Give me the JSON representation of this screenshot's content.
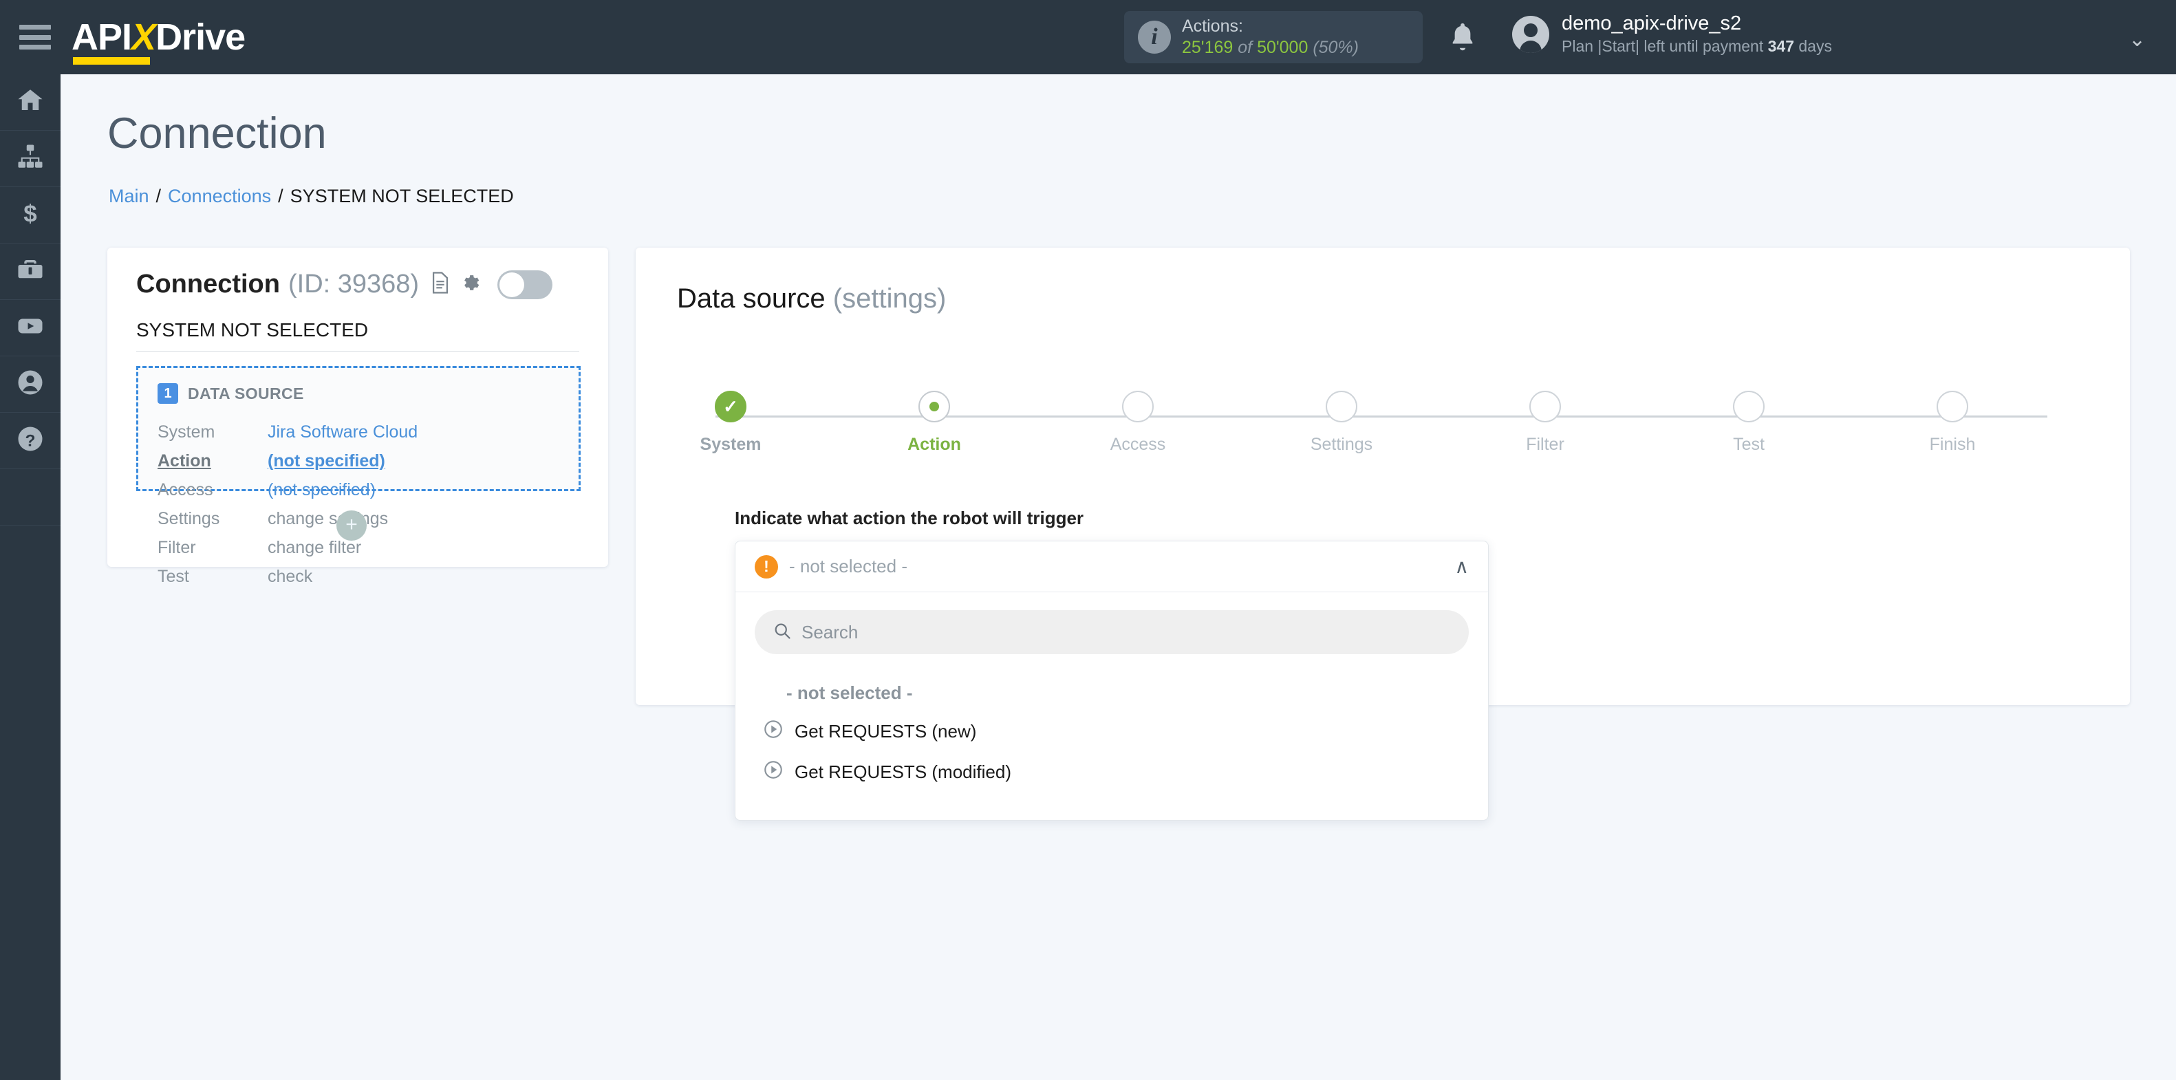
{
  "topbar": {
    "menu_icon": "hamburger-icon",
    "logo": {
      "part1": "API",
      "part2": "X",
      "part3": "Drive"
    },
    "actions": {
      "icon": "info-icon",
      "title": "Actions:",
      "used": "25'169",
      "of": "of",
      "total": "50'000",
      "percent": "(50%)"
    },
    "notifications_icon": "bell-icon",
    "user": {
      "avatar_icon": "user-avatar-icon",
      "name": "demo_apix-drive_s2",
      "plan_prefix": "Plan |Start| left until payment ",
      "plan_days": "347",
      "plan_suffix": " days",
      "chevron_icon": "chevron-down-icon"
    }
  },
  "sidebar": {
    "items": [
      {
        "icon": "home-icon",
        "name": "home"
      },
      {
        "icon": "connections-icon",
        "name": "connections"
      },
      {
        "icon": "dollar-icon",
        "name": "billing"
      },
      {
        "icon": "briefcase-icon",
        "name": "business"
      },
      {
        "icon": "youtube-icon",
        "name": "video"
      },
      {
        "icon": "account-icon",
        "name": "account"
      },
      {
        "icon": "help-icon",
        "name": "help"
      }
    ]
  },
  "page": {
    "title": "Connection",
    "breadcrumb": {
      "main": "Main",
      "connections": "Connections",
      "current": "SYSTEM NOT SELECTED",
      "separator": "/"
    }
  },
  "connection_card": {
    "title": "Connection",
    "id_label": "(ID: 39368)",
    "doc_icon": "document-icon",
    "gear_icon": "gear-icon",
    "toggle_state": "off",
    "subtitle": "SYSTEM NOT SELECTED",
    "data_source": {
      "badge": "1",
      "heading": "DATA SOURCE",
      "rows": [
        {
          "key": "System",
          "value": "Jira Software Cloud",
          "style": "link",
          "active": false
        },
        {
          "key": "Action",
          "value": "(not specified)",
          "style": "link",
          "active": true
        },
        {
          "key": "Access",
          "value": "(not specified)",
          "style": "link",
          "active": false
        },
        {
          "key": "Settings",
          "value": "change settings",
          "style": "gray",
          "active": false
        },
        {
          "key": "Filter",
          "value": "change filter",
          "style": "gray",
          "active": false
        },
        {
          "key": "Test",
          "value": "check",
          "style": "gray",
          "active": false
        }
      ]
    },
    "add_button": "+"
  },
  "settings_panel": {
    "title": "Data source",
    "title_muted": "(settings)",
    "steps": [
      {
        "label": "System",
        "state": "done"
      },
      {
        "label": "Action",
        "state": "current"
      },
      {
        "label": "Access",
        "state": "pending"
      },
      {
        "label": "Settings",
        "state": "pending"
      },
      {
        "label": "Filter",
        "state": "pending"
      },
      {
        "label": "Test",
        "state": "pending"
      },
      {
        "label": "Finish",
        "state": "pending"
      }
    ],
    "field_label": "Indicate what action the robot will trigger",
    "select": {
      "warn_icon": "warning-icon",
      "value": "- not selected -",
      "chevron": "∧",
      "search_icon": "search-icon",
      "search_placeholder": "Search",
      "options": [
        {
          "label": "- not selected -",
          "icon": null
        },
        {
          "label": "Get REQUESTS (new)",
          "icon": "play-icon"
        },
        {
          "label": "Get REQUESTS (modified)",
          "icon": "play-icon"
        }
      ]
    }
  },
  "colors": {
    "topbar_bg": "#2b3742",
    "accent_yellow": "#ffd400",
    "accent_blue": "#4a90e2",
    "accent_green": "#7cb342",
    "warning_orange": "#f7921e",
    "page_bg": "#f4f7fb"
  }
}
